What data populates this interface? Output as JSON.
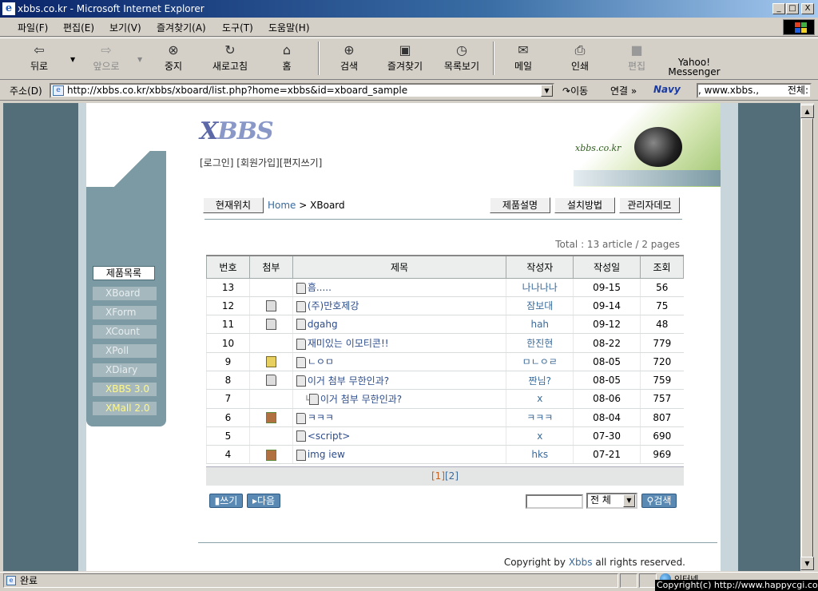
{
  "window": {
    "title": "xbbs.co.kr - Microsoft Internet Explorer",
    "min": "_",
    "max": "□",
    "close": "X"
  },
  "menu": [
    "파일(F)",
    "편집(E)",
    "보기(V)",
    "즐겨찾기(A)",
    "도구(T)",
    "도움말(H)"
  ],
  "toolbar": {
    "back": "뒤로",
    "forward": "앞으로",
    "stop": "중지",
    "refresh": "새로고침",
    "home": "홈",
    "search": "검색",
    "favorites": "즐겨찾기",
    "history": "목록보기",
    "mail": "메일",
    "print": "인쇄",
    "edit": "편집",
    "messenger1": "Yahoo!",
    "messenger2": "Messenger"
  },
  "address": {
    "label": "주소(D)",
    "url": "http://xbbs.co.kr/xbbs/xboard/list.php?home=xbbs&id=xboard_sample",
    "go": "이동",
    "links": "연결 »",
    "navy_value": ", www.xbbs.,",
    "navy_all": "전체:",
    "navy_logo": "Navy"
  },
  "site": {
    "logo_x": "X",
    "logo_bbs": "BBS",
    "top_links": "[로그인] [회원가입][편지쓰기]",
    "banner_text": "xbbs.co.kr"
  },
  "side": {
    "title": "제품목록",
    "items": [
      "XBoard",
      "XForm",
      "XCount",
      "XPoll",
      "XDiary",
      "XBBS 3.0",
      "XMall 2.0"
    ]
  },
  "nav": {
    "location_btn": "현재위치",
    "home": "Home",
    "sep": ">",
    "current": "XBoard",
    "btn_product": "제품설명",
    "btn_install": "설치방법",
    "btn_admin": "관리자데모"
  },
  "board": {
    "total": "Total : 13 article / 2 pages",
    "headers": [
      "번호",
      "첨부",
      "제목",
      "작성자",
      "작성일",
      "조회"
    ],
    "rows": [
      {
        "no": "13",
        "att": "",
        "subject": "흠.....",
        "author": "나나나나",
        "date": "09-15",
        "views": "56"
      },
      {
        "no": "12",
        "att": "doc",
        "subject": "(주)만호제강",
        "author": "잠보대",
        "date": "09-14",
        "views": "75"
      },
      {
        "no": "11",
        "att": "doc",
        "subject": "dgahg",
        "author": "hah",
        "date": "09-12",
        "views": "48"
      },
      {
        "no": "10",
        "att": "",
        "subject": "재미있는 이모티콘!!",
        "author": "한진현",
        "date": "08-22",
        "views": "779"
      },
      {
        "no": "9",
        "att": "zip",
        "subject": "ㄴㅇㅁ",
        "author": "ㅁㄴㅇㄹ",
        "date": "08-05",
        "views": "720"
      },
      {
        "no": "8",
        "att": "doc",
        "subject": "이거 첨부 무한인과?",
        "author": "짠님?",
        "date": "08-05",
        "views": "759"
      },
      {
        "no": "7",
        "att": "",
        "subject": "이거 첨부 무한인과?",
        "author": "x",
        "date": "08-06",
        "views": "757",
        "reply": true
      },
      {
        "no": "6",
        "att": "img",
        "subject": "ㅋㅋㅋ",
        "author": "ㅋㅋㅋ",
        "date": "08-04",
        "views": "807"
      },
      {
        "no": "5",
        "att": "",
        "subject": "<script>",
        "author": "x",
        "date": "07-30",
        "views": "690"
      },
      {
        "no": "4",
        "att": "img",
        "subject": "img iew",
        "author": "hks",
        "date": "07-21",
        "views": "969"
      }
    ],
    "pager_current": "[1]",
    "pager_next": "[2]"
  },
  "actions": {
    "write": "쓰기",
    "next": "다음",
    "select": "전 체",
    "search": "검색"
  },
  "footer": {
    "copy_prefix": "Copyright by",
    "copy_name": "Xbbs",
    "copy_suffix": "all rights reserved."
  },
  "status": {
    "text": "완료",
    "zone": "인터넷",
    "watermark": "Copyright(c) http://www.happycgi.com"
  }
}
